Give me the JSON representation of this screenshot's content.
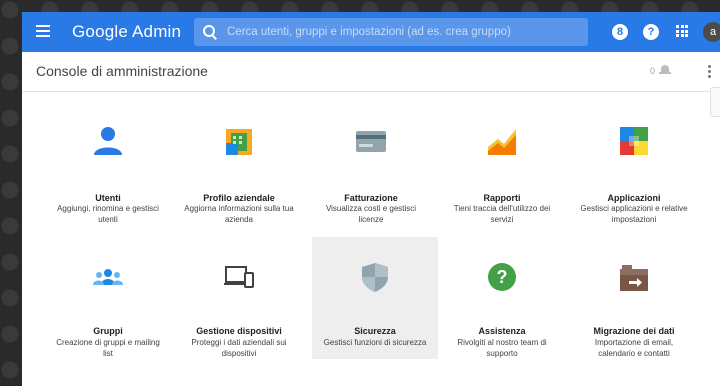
{
  "topbar": {
    "logo": "Google Admin",
    "search_placeholder": "Cerca utenti, gruppi e impostazioni (ad es. crea gruppo)",
    "notifications_badge": "8",
    "help_glyph": "?",
    "avatar_initial": "a",
    "colors": {
      "bar": "#2979e6",
      "search": "#5a97eb"
    }
  },
  "subbar": {
    "title": "Console di amministrazione",
    "notification_count": "0"
  },
  "tiles": [
    {
      "title": "Utenti",
      "desc": "Aggiungi, rinomina e gestisci utenti",
      "icon": "users-icon"
    },
    {
      "title": "Profilo aziendale",
      "desc": "Aggiorna informazioni sulla tua azienda",
      "icon": "company-profile-icon"
    },
    {
      "title": "Fatturazione",
      "desc": "Visualizza costi e gestisci licenze",
      "icon": "billing-card-icon"
    },
    {
      "title": "Rapporti",
      "desc": "Tieni traccia dell'utilizzo dei servizi",
      "icon": "reports-chart-icon"
    },
    {
      "title": "Applicazioni",
      "desc": "Gestisci applicazioni e relative impostazioni",
      "icon": "apps-grid-icon"
    },
    {
      "title": "Gruppi",
      "desc": "Creazione di gruppi e mailing list",
      "icon": "groups-icon"
    },
    {
      "title": "Gestione dispositivi",
      "desc": "Proteggi i dati aziendali sui dispositivi",
      "icon": "devices-icon"
    },
    {
      "title": "Sicurezza",
      "desc": "Gestisci funzioni di sicurezza",
      "icon": "security-shield-icon"
    },
    {
      "title": "Assistenza",
      "desc": "Rivolgiti al nostro team di supporto",
      "icon": "support-help-icon"
    },
    {
      "title": "Migrazione dei dati",
      "desc": "Importazione di email, calendario e contatti",
      "icon": "data-migration-icon"
    }
  ]
}
